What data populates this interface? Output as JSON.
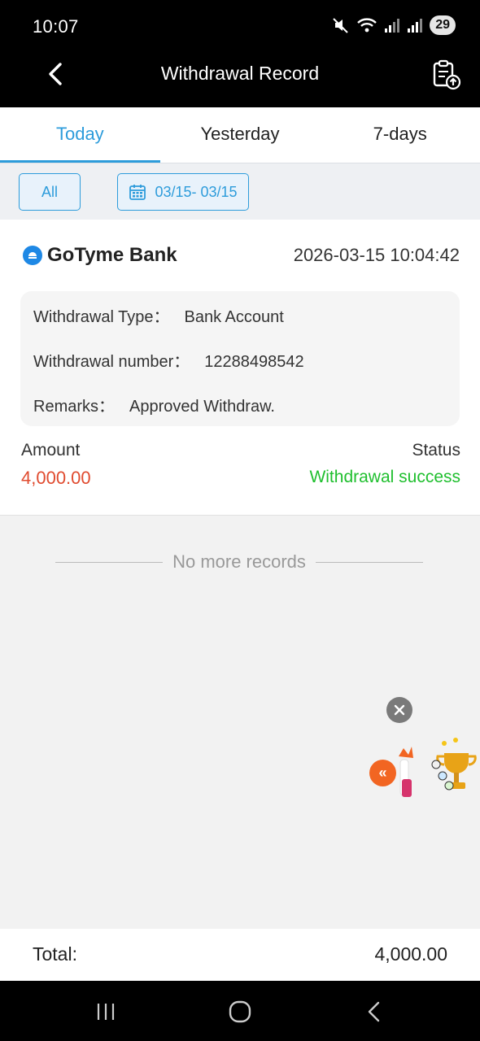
{
  "status_bar": {
    "time": "10:07",
    "battery": "29",
    "icons": [
      "mute-icon",
      "wifi-icon",
      "signal-icon",
      "signal-icon"
    ]
  },
  "header": {
    "title": "Withdrawal Record",
    "back_icon": "chevron-left-icon",
    "action_icon": "clipboard-upload-icon"
  },
  "tabs": [
    {
      "label": "Today",
      "active": true
    },
    {
      "label": "Yesterday",
      "active": false
    },
    {
      "label": "7-days",
      "active": false
    }
  ],
  "filters": {
    "type_label": "All",
    "date_range": "03/15- 03/15",
    "date_icon": "calendar-icon"
  },
  "record": {
    "bank_name": "GoTyme Bank",
    "datetime": "2026-03-15 10:04:42",
    "details": [
      {
        "label": "Withdrawal Type：",
        "value": "Bank Account"
      },
      {
        "label": "Withdrawal number：",
        "value": "12288498542"
      },
      {
        "label": "Remarks：",
        "value": "Approved Withdraw."
      }
    ],
    "amount_label": "Amount",
    "amount_value": "4,000.00",
    "status_label": "Status",
    "status_value": "Withdrawal success"
  },
  "list_end_text": "No more records",
  "footer": {
    "total_label": "Total:",
    "total_value": "4,000.00"
  },
  "colors": {
    "accent": "#2d9cdb",
    "amount": "#e04b2f",
    "success": "#1fbf2e",
    "promo": "#f26522"
  }
}
